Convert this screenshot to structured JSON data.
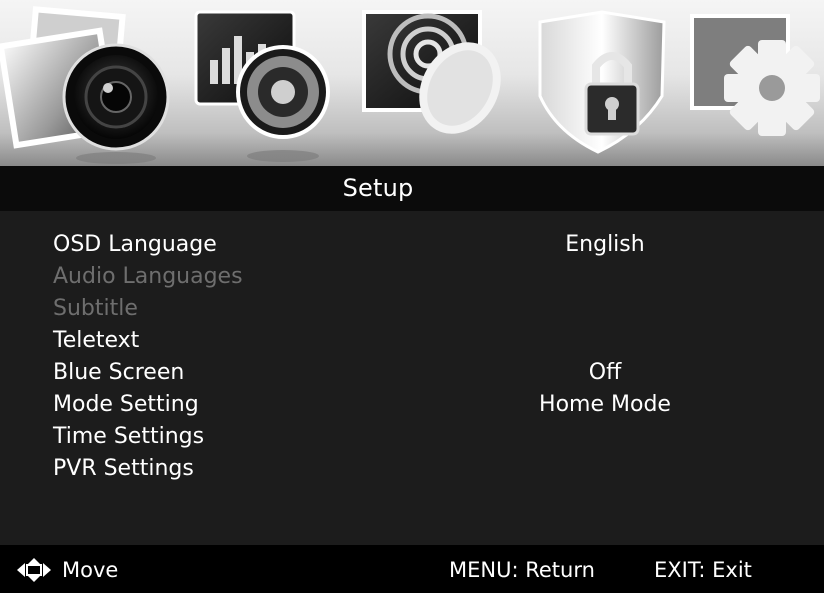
{
  "header": {
    "categories": [
      {
        "name": "picture",
        "icon": "picture-camera-icon"
      },
      {
        "name": "sound",
        "icon": "sound-speaker-icon"
      },
      {
        "name": "channel",
        "icon": "channel-satellite-icon"
      },
      {
        "name": "lock",
        "icon": "shield-lock-icon"
      },
      {
        "name": "setup",
        "icon": "setup-gear-icon"
      }
    ],
    "selected": "setup"
  },
  "title": "Setup",
  "menu": {
    "items": [
      {
        "label": "OSD Language",
        "value": "English",
        "enabled": true
      },
      {
        "label": "Audio Languages",
        "value": "",
        "enabled": false
      },
      {
        "label": "Subtitle",
        "value": "",
        "enabled": false
      },
      {
        "label": "Teletext",
        "value": "",
        "enabled": true
      },
      {
        "label": "Blue Screen",
        "value": "Off",
        "enabled": true
      },
      {
        "label": "Mode Setting",
        "value": "Home Mode",
        "enabled": true
      },
      {
        "label": "Time Settings",
        "value": "",
        "enabled": true
      },
      {
        "label": "PVR Settings",
        "value": "",
        "enabled": true
      }
    ]
  },
  "footer": {
    "move_icon": "four-way-arrow-icon",
    "move_label": "Move",
    "menu_hint": "MENU: Return",
    "exit_hint": "EXIT: Exit"
  },
  "colors": {
    "panel_bg": "#1c1c1c",
    "text": "#ffffff",
    "disabled_text": "#6e6e6e"
  }
}
